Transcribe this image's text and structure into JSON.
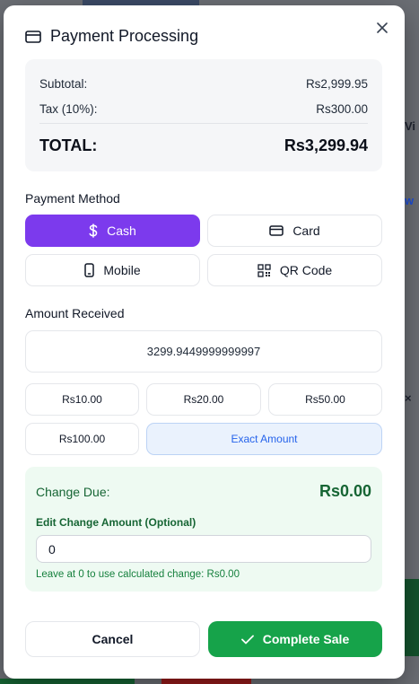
{
  "modal": {
    "title": "Payment Processing",
    "icon": "credit-card-icon"
  },
  "summary": {
    "subtotal_label": "Subtotal:",
    "subtotal_value": "Rs2,999.95",
    "tax_label": "Tax (10%):",
    "tax_value": "Rs300.00",
    "total_label": "TOTAL:",
    "total_value": "Rs3,299.94"
  },
  "payment_method": {
    "label": "Payment Method",
    "selected": "Cash",
    "options": [
      {
        "label": "Cash",
        "icon": "dollar-icon"
      },
      {
        "label": "Card",
        "icon": "credit-card-icon"
      },
      {
        "label": "Mobile",
        "icon": "smartphone-icon"
      },
      {
        "label": "QR Code",
        "icon": "qr-code-icon"
      }
    ]
  },
  "amount_received": {
    "label": "Amount Received",
    "value": "3299.9449999999997",
    "quick_amounts": [
      "Rs10.00",
      "Rs20.00",
      "Rs50.00",
      "Rs100.00"
    ],
    "exact_label": "Exact Amount"
  },
  "change": {
    "label": "Change Due:",
    "value": "Rs0.00",
    "edit_label": "Edit Change Amount (Optional)",
    "edit_value": "0",
    "hint": "Leave at 0 to use calculated change: Rs0.00"
  },
  "actions": {
    "cancel": "Cancel",
    "complete": "Complete Sale"
  },
  "colors": {
    "accent": "#7c3aed",
    "success": "#16a34a",
    "exact_bg": "#eaf2fd",
    "change_bg": "#eefaf2"
  }
}
